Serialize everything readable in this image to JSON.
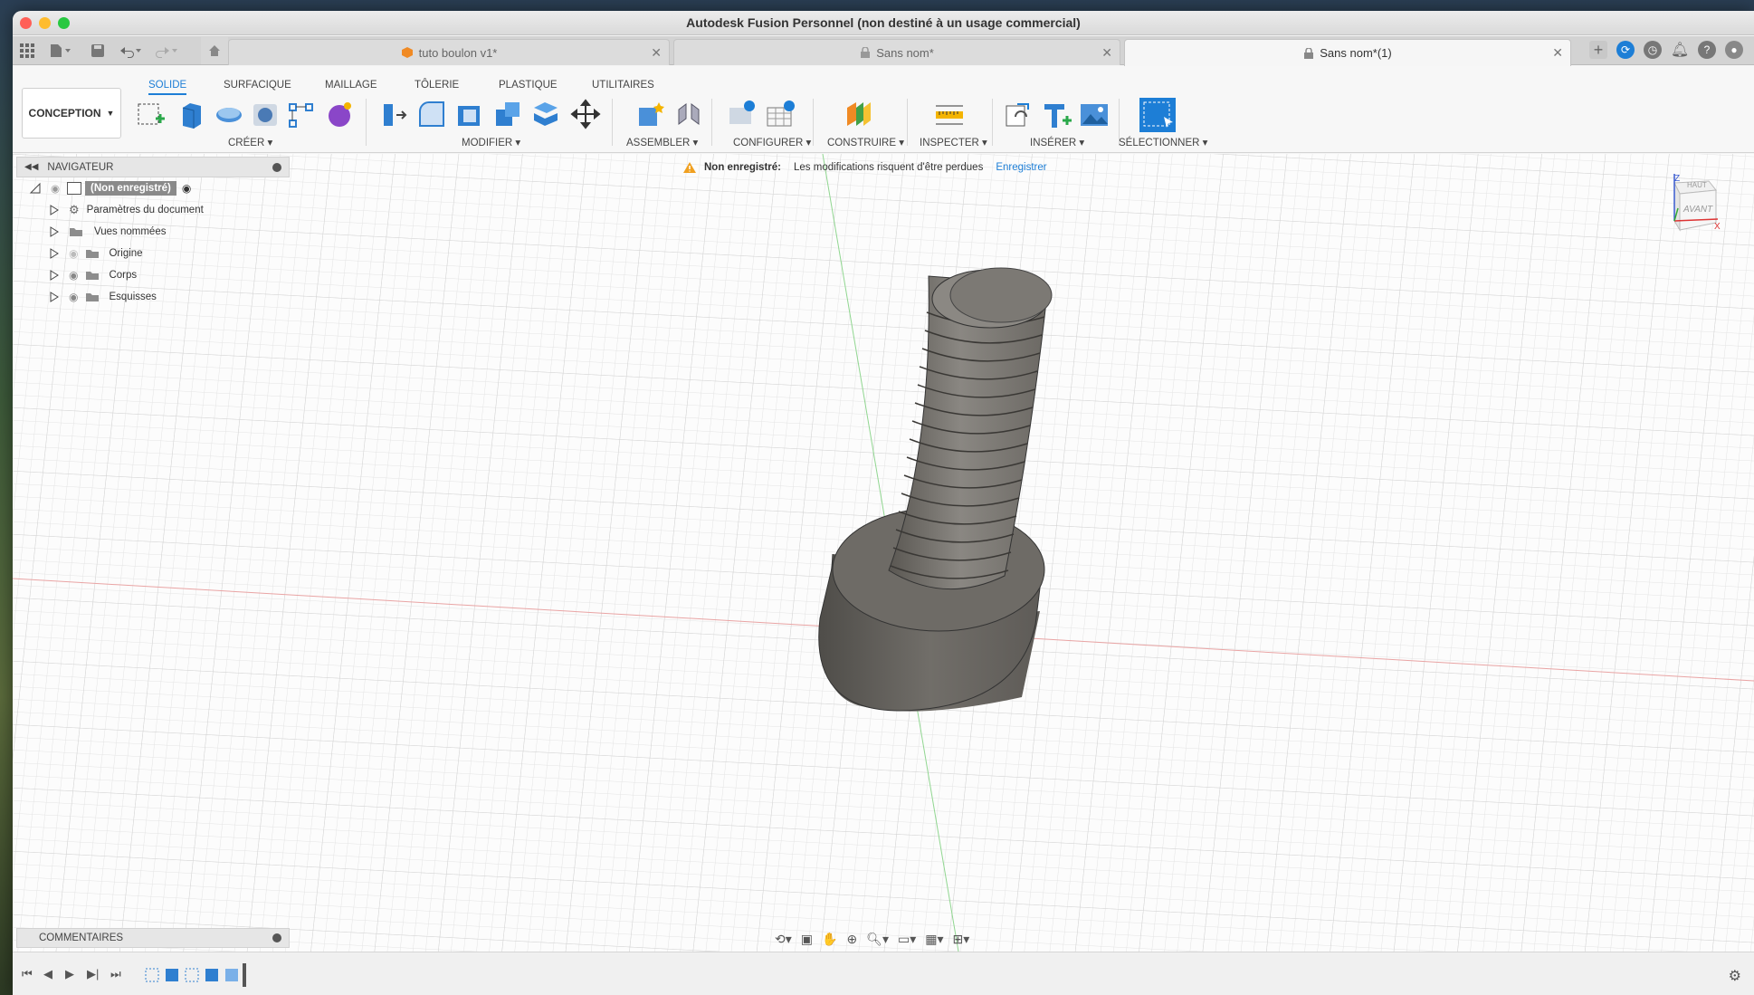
{
  "window": {
    "title": "Autodesk Fusion Personnel (non destiné à un usage commercial)"
  },
  "tabs": [
    {
      "label": "tuto boulon v1*",
      "active": false
    },
    {
      "label": "Sans nom*",
      "active": false
    },
    {
      "label": "Sans nom*(1)",
      "active": true
    }
  ],
  "ribbon": {
    "workspace": "CONCEPTION",
    "tabs": [
      "SOLIDE",
      "SURFACIQUE",
      "MAILLAGE",
      "TÔLERIE",
      "PLASTIQUE",
      "UTILITAIRES"
    ],
    "groups": [
      "CRÉER",
      "MODIFIER",
      "ASSEMBLER",
      "CONFIGURER",
      "CONSTRUIRE",
      "INSPECTER",
      "INSÉRER",
      "SÉLECTIONNER"
    ]
  },
  "navigator": {
    "title": "NAVIGATEUR",
    "root": "(Non enregistré)",
    "items": [
      {
        "label": "Paramètres du document",
        "icon": "gear-icon"
      },
      {
        "label": "Vues nommées",
        "icon": "folder-icon"
      },
      {
        "label": "Origine",
        "icon": "folder-icon"
      },
      {
        "label": "Corps",
        "icon": "folder-icon"
      },
      {
        "label": "Esquisses",
        "icon": "folder-icon"
      }
    ]
  },
  "warning": {
    "label": "Non enregistré:",
    "message": "Les modifications risquent d'être perdues",
    "action": "Enregistrer"
  },
  "viewcube": {
    "top": "HAUT",
    "front": "AVANT",
    "z": "Z",
    "x": "X"
  },
  "comments": {
    "label": "COMMENTAIRES"
  },
  "colors": {
    "accent": "#1d7ed6",
    "model": "#6e6b66",
    "x_axis": "#e8a0a0",
    "y_axis": "#8fd08f"
  }
}
